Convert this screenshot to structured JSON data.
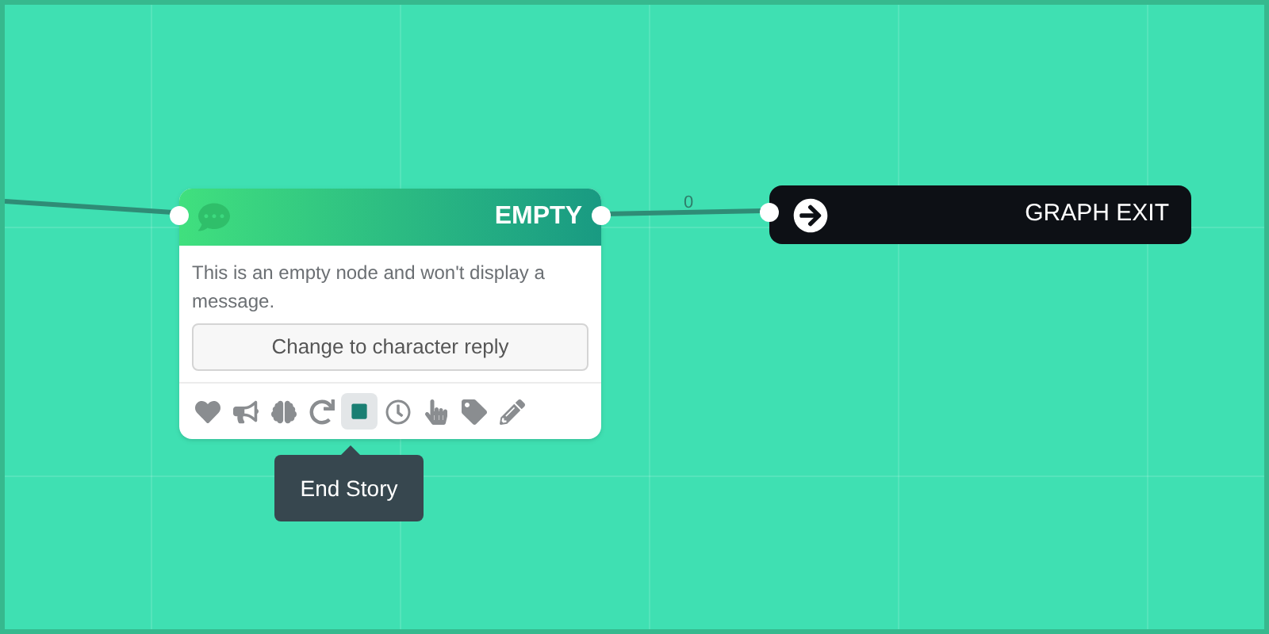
{
  "node": {
    "title": "EMPTY",
    "message": "This is an empty node and won't display a message.",
    "action_button": "Change to character reply",
    "toolbar": [
      {
        "kind": "heart",
        "selected": false
      },
      {
        "kind": "megaphone",
        "selected": false
      },
      {
        "kind": "brain",
        "selected": false
      },
      {
        "kind": "rotate",
        "selected": false
      },
      {
        "kind": "square",
        "selected": true
      },
      {
        "kind": "clock",
        "selected": false
      },
      {
        "kind": "hand",
        "selected": false
      },
      {
        "kind": "tag",
        "selected": false
      },
      {
        "kind": "pencil",
        "selected": false
      }
    ]
  },
  "connection_label": "0",
  "exit_node": {
    "title": "GRAPH EXIT"
  },
  "tooltip": "End Story"
}
